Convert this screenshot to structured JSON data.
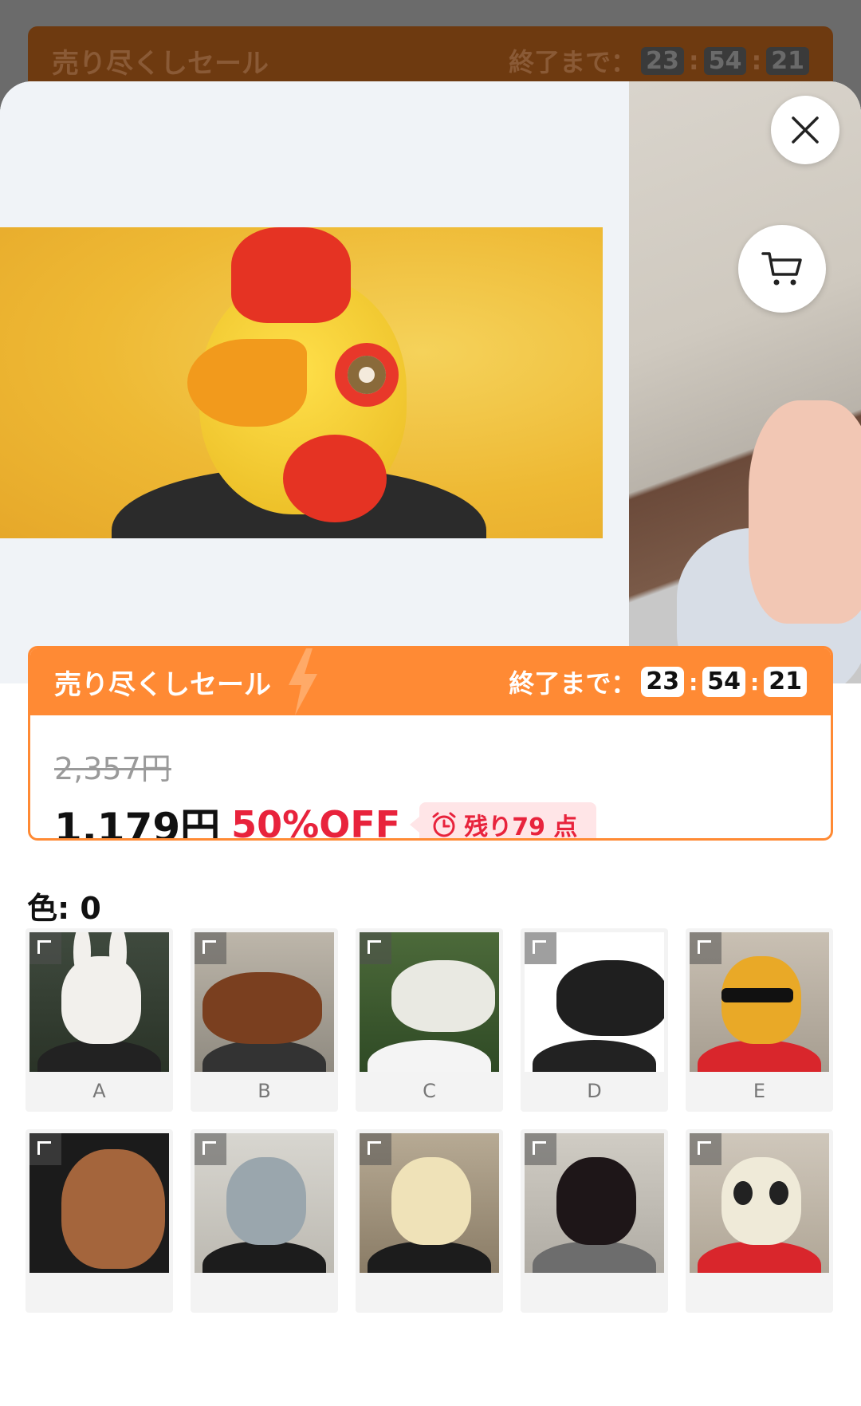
{
  "background": {
    "sale_title": "売り尽くしセール",
    "ends_label": "終了まで：",
    "timer": [
      "23",
      "54",
      "21"
    ]
  },
  "sheet": {
    "close_icon": "close-icon",
    "cart_icon": "cart-icon",
    "sale": {
      "title": "売り尽くしセール",
      "ends_label": "終了まで：",
      "hours": "23",
      "minutes": "54",
      "seconds": "21",
      "original_price": "2,357円",
      "price": "1,179円",
      "discount": "50%OFF",
      "stock": "残り79 点",
      "accent_color": "#ff8a34",
      "discount_color": "#e8233c"
    },
    "color_label": "色: 0",
    "variants": [
      {
        "label": "A"
      },
      {
        "label": "B"
      },
      {
        "label": "C"
      },
      {
        "label": "D"
      },
      {
        "label": "E"
      },
      {
        "label": ""
      },
      {
        "label": ""
      },
      {
        "label": ""
      },
      {
        "label": ""
      },
      {
        "label": ""
      }
    ]
  }
}
